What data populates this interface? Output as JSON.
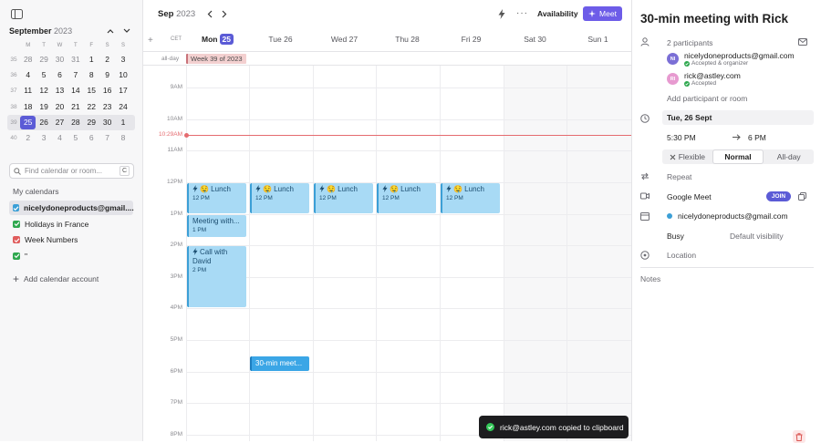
{
  "sidebar": {
    "mini_month": "September",
    "mini_year": "2023",
    "dow": [
      "M",
      "T",
      "W",
      "T",
      "F",
      "S",
      "S"
    ],
    "weeks": [
      {
        "wk": "35",
        "days": [
          "28",
          "29",
          "30",
          "31",
          "1",
          "2",
          "3"
        ],
        "muted": [
          true,
          true,
          true,
          true,
          false,
          false,
          false
        ]
      },
      {
        "wk": "36",
        "days": [
          "4",
          "5",
          "6",
          "7",
          "8",
          "9",
          "10"
        ],
        "muted": [
          false,
          false,
          false,
          false,
          false,
          false,
          false
        ]
      },
      {
        "wk": "37",
        "days": [
          "11",
          "12",
          "13",
          "14",
          "15",
          "16",
          "17"
        ],
        "muted": [
          false,
          false,
          false,
          false,
          false,
          false,
          false
        ]
      },
      {
        "wk": "38",
        "days": [
          "18",
          "19",
          "20",
          "21",
          "22",
          "23",
          "24"
        ],
        "muted": [
          false,
          false,
          false,
          false,
          false,
          false,
          false
        ]
      },
      {
        "wk": "39",
        "days": [
          "25",
          "26",
          "27",
          "28",
          "29",
          "30",
          "1"
        ],
        "muted": [
          false,
          false,
          false,
          false,
          false,
          false,
          false
        ]
      },
      {
        "wk": "40",
        "days": [
          "2",
          "3",
          "4",
          "5",
          "6",
          "7",
          "8"
        ],
        "muted": [
          true,
          true,
          true,
          true,
          true,
          true,
          true
        ]
      }
    ],
    "search_placeholder": "Find calendar or room...",
    "search_shortcut": "C",
    "my_calendars_label": "My calendars",
    "calendars": [
      {
        "name": "nicelydoneproducts@gmail....",
        "color": "#3b9fd6",
        "selected": true
      },
      {
        "name": "Holidays in France",
        "color": "#2fa84f",
        "selected": false
      },
      {
        "name": "Week Numbers",
        "color": "#e05d5d",
        "selected": false
      },
      {
        "name": "\"",
        "color": "#2fa84f",
        "selected": false
      }
    ],
    "add_account": "Add calendar account"
  },
  "toolbar": {
    "month": "Sep",
    "year": "2023",
    "availability": "Availability",
    "meet": "Meet"
  },
  "week": {
    "timezone": "CET",
    "days": [
      {
        "label": "Mon",
        "num": "25",
        "today": true
      },
      {
        "label": "Tue 26"
      },
      {
        "label": "Wed 27"
      },
      {
        "label": "Thu 28"
      },
      {
        "label": "Fri 29"
      },
      {
        "label": "Sat 30"
      },
      {
        "label": "Sun 1"
      }
    ],
    "allday_label": "all-day",
    "allday_event": "Week 39 of 2023",
    "hours": [
      "9AM",
      "10AM",
      "11AM",
      "12PM",
      "1PM",
      "2PM",
      "3PM",
      "4PM",
      "5PM",
      "6PM",
      "7PM",
      "8PM"
    ],
    "now_label": "10:29AM",
    "events": [
      {
        "day": 0,
        "title": "🤤 Lunch",
        "sub": "12 PM",
        "bolt": true,
        "start": 12,
        "end": 13
      },
      {
        "day": 1,
        "title": "🤤 Lunch",
        "sub": "12 PM",
        "bolt": true,
        "start": 12,
        "end": 13
      },
      {
        "day": 2,
        "title": "🤤 Lunch",
        "sub": "12 PM",
        "bolt": true,
        "start": 12,
        "end": 13
      },
      {
        "day": 3,
        "title": "🤤 Lunch",
        "sub": "12 PM",
        "bolt": true,
        "start": 12,
        "end": 13
      },
      {
        "day": 4,
        "title": "🤤 Lunch",
        "sub": "12 PM",
        "bolt": true,
        "start": 12,
        "end": 13
      },
      {
        "day": 0,
        "title": "Meeting with...",
        "sub": "1 PM",
        "bolt": false,
        "start": 13,
        "end": 13.75
      },
      {
        "day": 0,
        "title": "Call with David",
        "sub": "2 PM",
        "bolt": true,
        "start": 14,
        "end": 16
      },
      {
        "day": 1,
        "title": "30-min meet...",
        "sub": "",
        "bolt": false,
        "start": 17.5,
        "end": 18,
        "dark": true
      }
    ]
  },
  "toast": {
    "text": "rick@astley.com copied to clipboard"
  },
  "panel": {
    "title": "30-min meeting with Rick",
    "participants_count": "2 participants",
    "participants": [
      {
        "initials": "NI",
        "email": "nicelydoneproducts@gmail.com",
        "status": "Accepted & organizer",
        "color": "#7b6fd6"
      },
      {
        "initials": "RI",
        "email": "rick@astley.com",
        "status": "Accepted",
        "color": "#e79ad0"
      }
    ],
    "add_participant": "Add participant or room",
    "date": "Tue, 26 Sept",
    "start_time": "5:30 PM",
    "end_time": "6 PM",
    "modes": [
      "Flexible",
      "Normal",
      "All-day"
    ],
    "repeat": "Repeat",
    "conferencing": "Google Meet",
    "join": "JOIN",
    "calendar": "nicelydoneproducts@gmail.com",
    "busy": "Busy",
    "visibility": "Default visibility",
    "location": "Location",
    "notes": "Notes"
  }
}
